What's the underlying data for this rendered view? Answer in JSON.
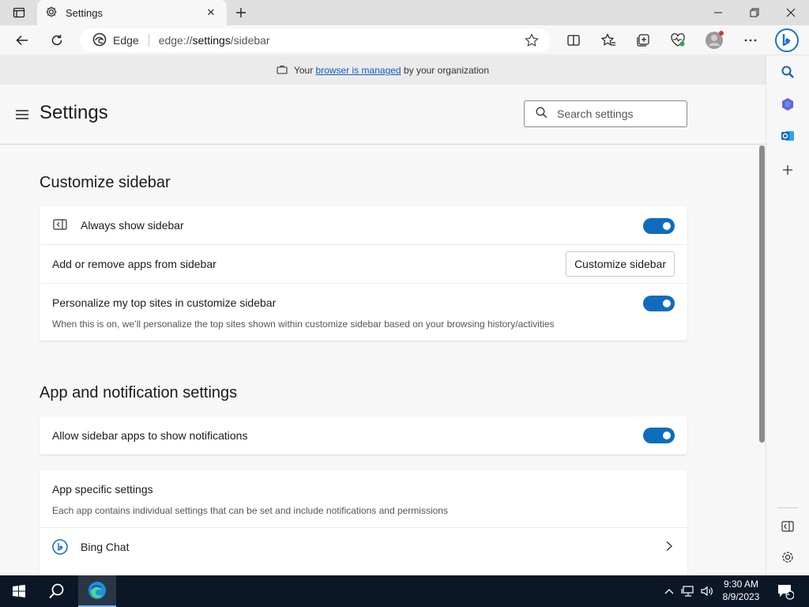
{
  "browser": {
    "tab_title": "Settings",
    "address_site": "Edge",
    "address_url_prefix": "edge://",
    "address_url_host": "settings",
    "address_url_path": "/sidebar"
  },
  "banner": {
    "prefix": "Your",
    "link": "browser is managed",
    "suffix": "by your organization"
  },
  "header": {
    "title": "Settings",
    "search_placeholder": "Search settings"
  },
  "customize": {
    "title": "Customize sidebar",
    "always_show_label": "Always show sidebar",
    "always_show_on": true,
    "add_remove_label": "Add or remove apps from sidebar",
    "customize_button": "Customize sidebar",
    "personalize_label": "Personalize my top sites in customize sidebar",
    "personalize_desc": "When this is on, we’ll personalize the top sites shown within customize sidebar based on your browsing history/activities",
    "personalize_on": true
  },
  "notifications": {
    "title": "App and notification settings",
    "allow_label": "Allow sidebar apps to show notifications",
    "allow_on": true,
    "app_specific_title": "App specific settings",
    "app_specific_desc": "Each app contains individual settings that can be set and include notifications and permissions",
    "apps": [
      {
        "label": "Bing Chat"
      }
    ]
  },
  "taskbar": {
    "time": "9:30 AM",
    "date": "8/9/2023",
    "notification_count": "1"
  },
  "colors": {
    "accent": "#0f6cbd",
    "taskbar": "#0b1626"
  }
}
